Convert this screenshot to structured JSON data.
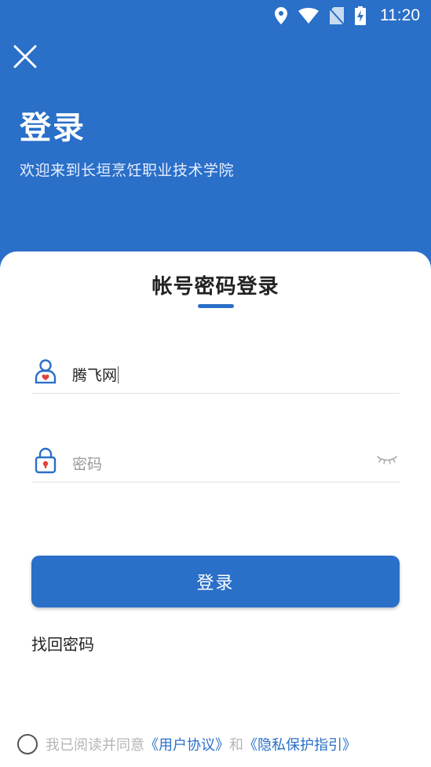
{
  "status_bar": {
    "time": "11:20"
  },
  "header": {
    "title": "登录",
    "subtitle": "欢迎来到长垣烹饪职业技术学院"
  },
  "form": {
    "tab_title": "帐号密码登录",
    "username_value": "腾飞网",
    "password_placeholder": "密码",
    "login_label": "登录",
    "forgot_label": "找回密码"
  },
  "agreement": {
    "prefix": "我已阅读并同意",
    "user_agreement": "《用户协议》",
    "conjunction": "和",
    "privacy_policy": "《隐私保护指引》"
  },
  "colors": {
    "primary": "#2a6fc8",
    "icon_red": "#e0443b"
  }
}
